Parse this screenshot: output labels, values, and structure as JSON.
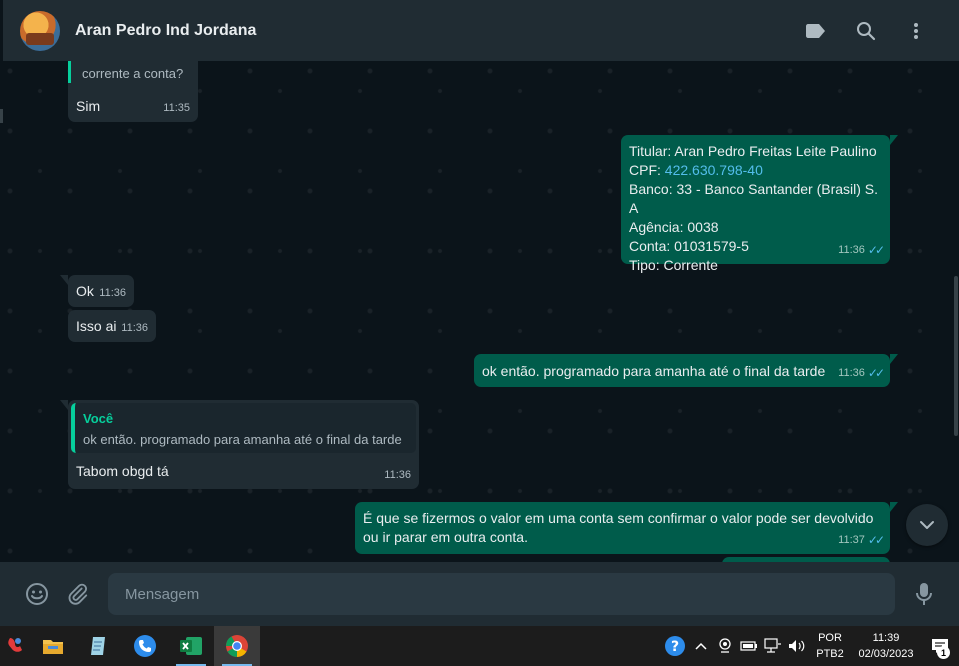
{
  "header": {
    "contact_name": "Aran Pedro Ind Jordana",
    "icons": [
      "label-icon",
      "search-icon",
      "menu-icon"
    ]
  },
  "messages": {
    "m1": {
      "prev_text": "corrente a conta?",
      "text": "Sim",
      "time": "11:35"
    },
    "m2": {
      "line1": "Titular: Aran Pedro Freitas Leite Paulino",
      "line2_label": "CPF: ",
      "line2_value": "422.630.798-40",
      "line3": "Banco: 33 - Banco Santander (Brasil) S. A",
      "line4": "Agência: 0038",
      "line5": "Conta: 01031579-5",
      "line6": "Tipo: Corrente",
      "time": "11:36"
    },
    "m3": {
      "text": "Ok",
      "time": "11:36"
    },
    "m4": {
      "text": "Isso ai",
      "time": "11:36"
    },
    "m5": {
      "text": "ok então. programado para amanha até o final da tarde",
      "time": "11:36"
    },
    "m6": {
      "quote_author": "Você",
      "quote_text": "ok então. programado para amanha até o final da tarde",
      "text": "Tabom obgd tá",
      "time": "11:36"
    },
    "m7": {
      "line1": "É que se fizermos o valor em uma conta sem confirmar o valor pode ser devolvido",
      "line2": "ou ir parar em outra conta.",
      "time": "11:37"
    }
  },
  "composer": {
    "placeholder": "Mensagem"
  },
  "taskbar": {
    "apps": [
      "app-icon-red",
      "file-explorer-icon",
      "notepad-icon",
      "phone-app-icon",
      "excel-icon",
      "chrome-icon"
    ],
    "lang_line1": "POR",
    "lang_line2": "PTB2",
    "time": "11:39",
    "date": "02/03/2023",
    "notification_count": "1"
  },
  "colors": {
    "header_bg": "#202c33",
    "chat_bg": "#0b141a",
    "incoming_bubble": "#202c33",
    "outgoing_bubble": "#005c4b",
    "accent": "#06cf9c",
    "read_ticks": "#53bdeb"
  }
}
